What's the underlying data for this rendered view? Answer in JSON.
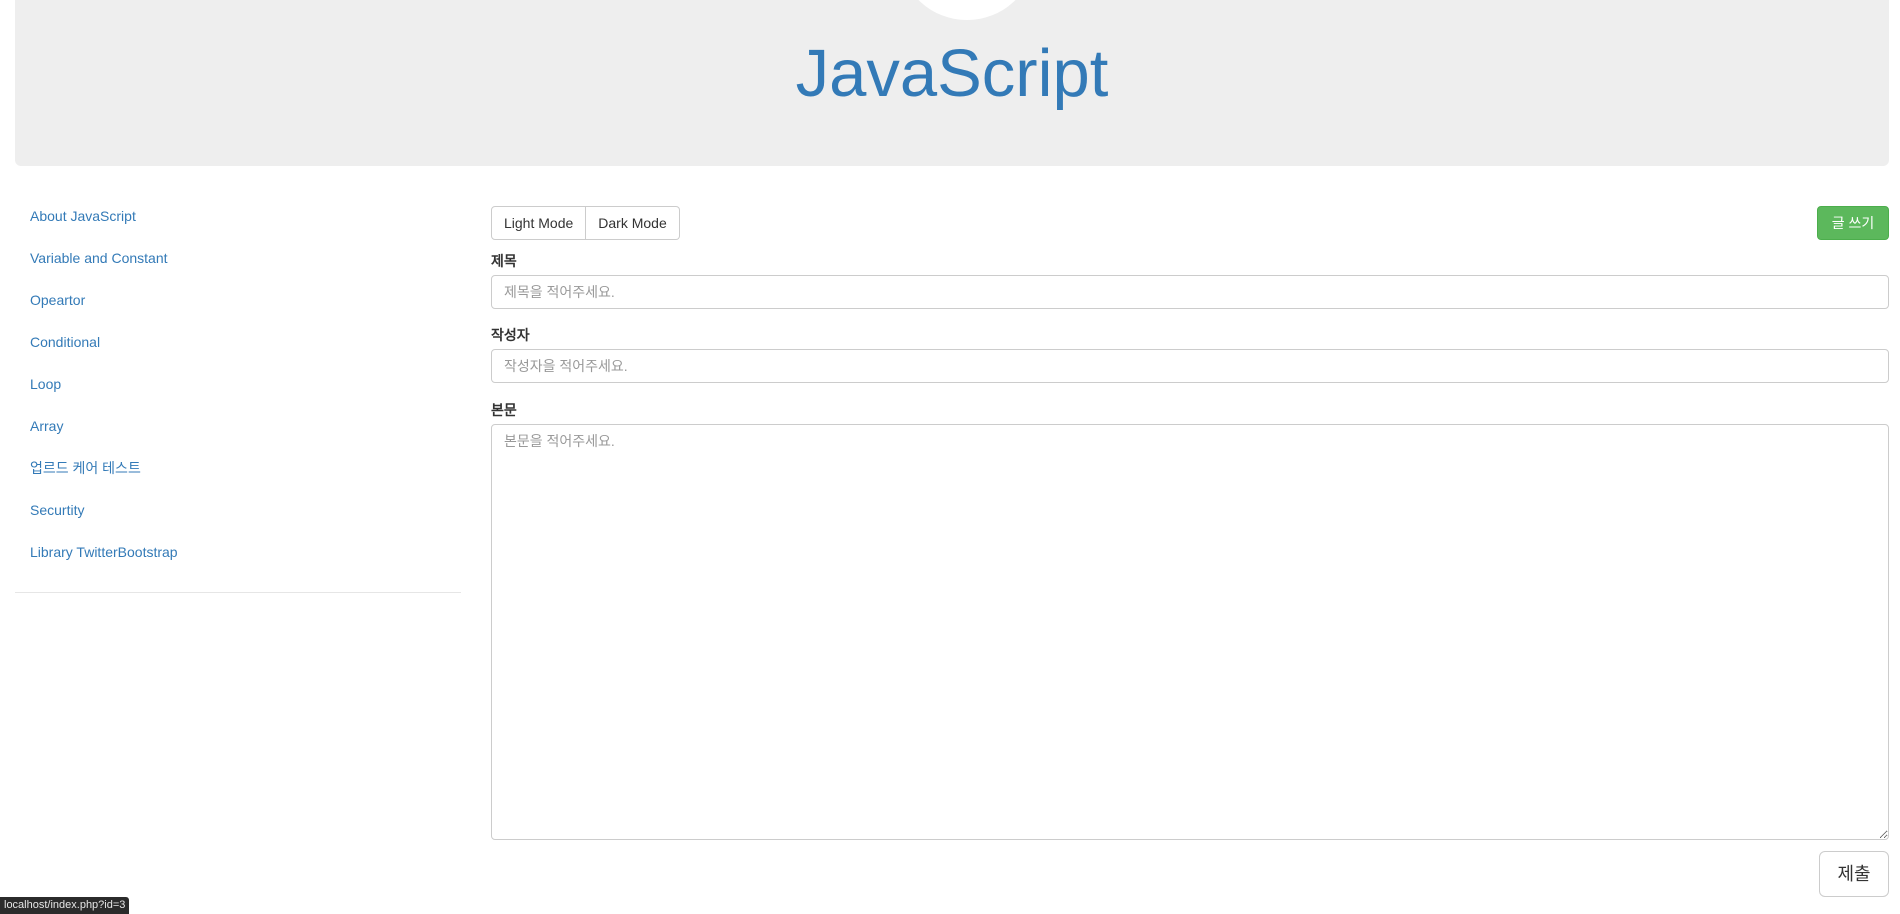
{
  "header": {
    "title": "JavaScript"
  },
  "sidebar": {
    "items": [
      {
        "label": "About JavaScript"
      },
      {
        "label": "Variable and Constant"
      },
      {
        "label": "Opeartor"
      },
      {
        "label": "Conditional"
      },
      {
        "label": "Loop"
      },
      {
        "label": "Array"
      },
      {
        "label": "업르드 케어 테스트"
      },
      {
        "label": "Securtity"
      },
      {
        "label": "Library TwitterBootstrap"
      }
    ]
  },
  "toolbar": {
    "light_mode_label": "Light Mode",
    "dark_mode_label": "Dark Mode",
    "write_label": "글 쓰기"
  },
  "form": {
    "title_label": "제목",
    "title_placeholder": "제목을 적어주세요.",
    "title_value": "",
    "author_label": "작성자",
    "author_placeholder": "작성자을 적어주세요.",
    "author_value": "",
    "body_label": "본문",
    "body_placeholder": "본문을 적어주세요.",
    "body_value": "",
    "submit_label": "제출"
  },
  "status_bar": {
    "url": "localhost/index.php?id=3"
  },
  "colors": {
    "link": "#337ab7",
    "success": "#5cb85c",
    "jumbotron_bg": "#eeeeee"
  }
}
